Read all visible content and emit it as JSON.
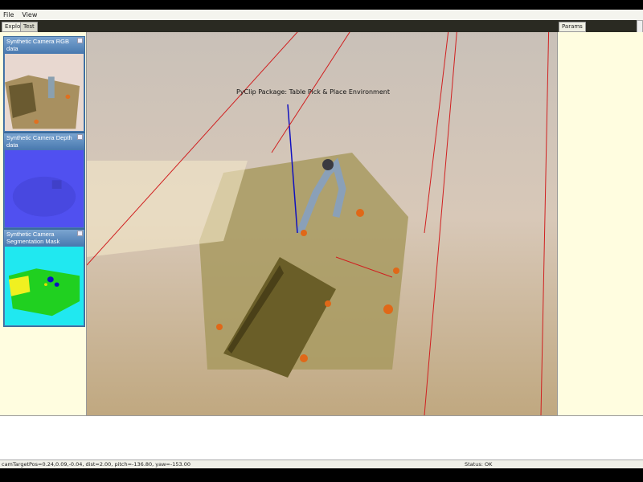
{
  "menu": {
    "items": [
      "File",
      "View"
    ]
  },
  "left_tabs": [
    "Explorer",
    "Test"
  ],
  "right_tabs": [
    "Params"
  ],
  "cameras": [
    {
      "title": "Synthetic Camera RGB data"
    },
    {
      "title": "Synthetic Camera Depth data"
    },
    {
      "title": "Synthetic Camera Segmentation Mask"
    }
  ],
  "viewport": {
    "title": "PyClip Package: Table Pick & Place Environment"
  },
  "status": {
    "camera": "camTargetPos=0.24,0.09,-0.04, dist=2.00, pitch=-136.80, yaw=-153.00",
    "state": "Status: OK"
  }
}
